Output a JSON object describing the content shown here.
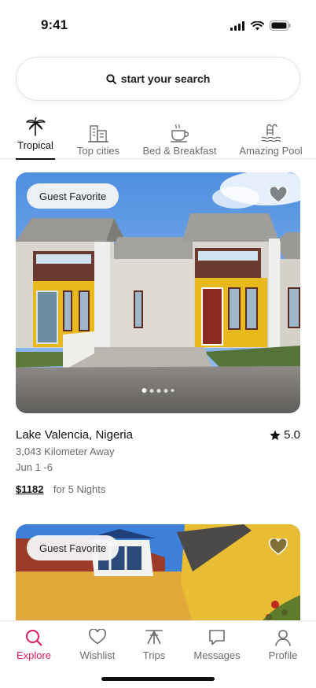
{
  "status": {
    "time": "9:41"
  },
  "search": {
    "placeholder": "start your search"
  },
  "categories": [
    {
      "label": "Tropical",
      "icon": "palm-tree-icon",
      "active": true
    },
    {
      "label": "Top cities",
      "icon": "city-buildings-icon",
      "active": false
    },
    {
      "label": "Bed & Breakfast",
      "icon": "coffee-cup-icon",
      "active": false
    },
    {
      "label": "Amazing Pool",
      "icon": "pool-ladder-icon",
      "active": false
    }
  ],
  "listings": [
    {
      "badge": "Guest Favorite",
      "title": "Lake Valencia, Nigeria",
      "rating": "5.0",
      "distance": "3,043 Kilometer Away",
      "dates": "Jun 1 -6",
      "price": "$1182",
      "nights": "for 5 Nights",
      "photo_index": 1,
      "photo_count": 5
    },
    {
      "badge": "Guest Favorite"
    }
  ],
  "nav": [
    {
      "label": "Explore",
      "icon": "search-icon",
      "active": true
    },
    {
      "label": "Wishlist",
      "icon": "heart-icon",
      "active": false
    },
    {
      "label": "Trips",
      "icon": "airbnb-logo-icon",
      "active": false
    },
    {
      "label": "Messages",
      "icon": "message-icon",
      "active": false
    },
    {
      "label": "Profile",
      "icon": "profile-icon",
      "active": false
    }
  ],
  "colors": {
    "accent": "#e11d5a",
    "text": "#1f1f1f",
    "muted": "#6b6b6b"
  }
}
